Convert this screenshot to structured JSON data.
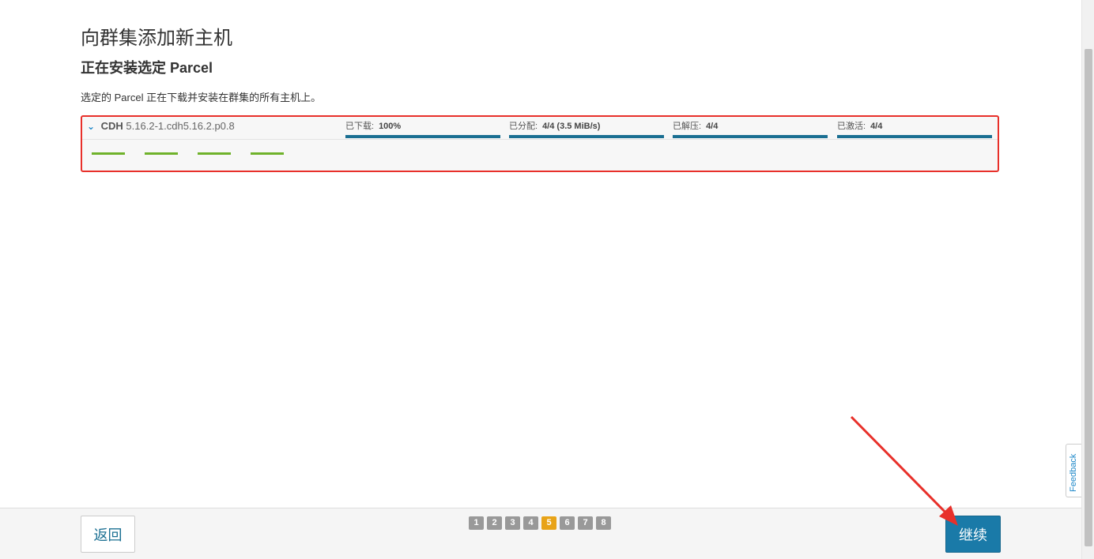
{
  "header": {
    "title": "向群集添加新主机",
    "subtitle": "正在安装选定 Parcel",
    "description": "选定的 Parcel 正在下载并安装在群集的所有主机上。"
  },
  "parcel": {
    "name": "CDH",
    "version": "5.16.2-1.cdh5.16.2.p0.8",
    "stages": [
      {
        "label": "已下载:",
        "value": "100%",
        "progress": 1.0
      },
      {
        "label": "已分配:",
        "value": "4/4 (3.5 MiB/s)",
        "progress": 1.0
      },
      {
        "label": "已解压:",
        "value": "4/4",
        "progress": 1.0
      },
      {
        "label": "已激活:",
        "value": "4/4",
        "progress": 1.0
      }
    ],
    "host_count": 4,
    "host_status_color": "#6fb22b"
  },
  "footer": {
    "back_label": "返回",
    "continue_label": "继续",
    "steps": [
      "1",
      "2",
      "3",
      "4",
      "5",
      "6",
      "7",
      "8"
    ],
    "active_step": "5"
  },
  "feedback": {
    "label": "Feedback"
  },
  "colors": {
    "accent": "#1a7aa8",
    "highlight_border": "#e8302a",
    "active_step": "#e8a317",
    "progress": "#1a6f92"
  }
}
